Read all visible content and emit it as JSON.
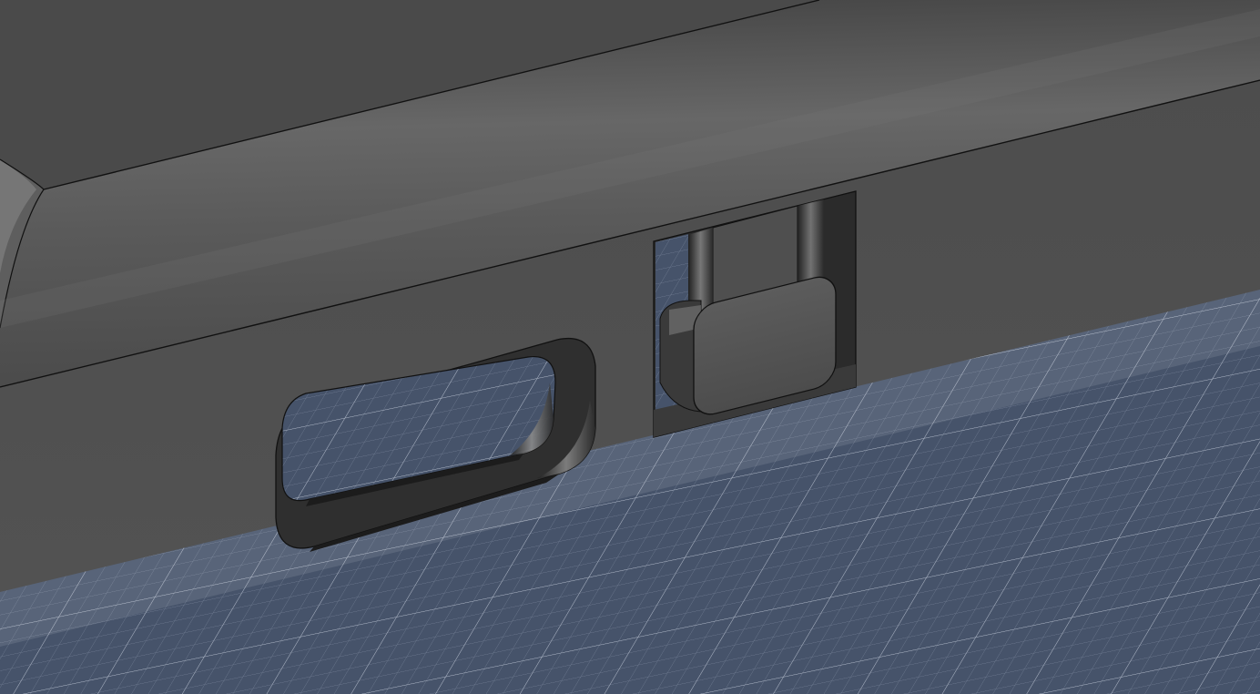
{
  "viewport": {
    "kind": "3d-cad-viewport",
    "content": "enclosure-edge-with-cutouts",
    "colors": {
      "grid_background": "#46536a",
      "grid_line_minor": "#6f7b91",
      "grid_line_major": "#9aa5b8",
      "body_face": "#505050",
      "body_top": "#4a4a4a",
      "body_highlight": "#6a6a6a",
      "edge_line": "#111111",
      "cutout_wall": "#2e2e2e",
      "tab_face": "#555555"
    },
    "features": {
      "usb_slot_cutout": {
        "icon": "rounded-slot-icon"
      },
      "switch_cutout": {
        "icon": "switch-slot-icon"
      },
      "slide_switch": {
        "icon": "slide-switch-icon"
      }
    }
  }
}
